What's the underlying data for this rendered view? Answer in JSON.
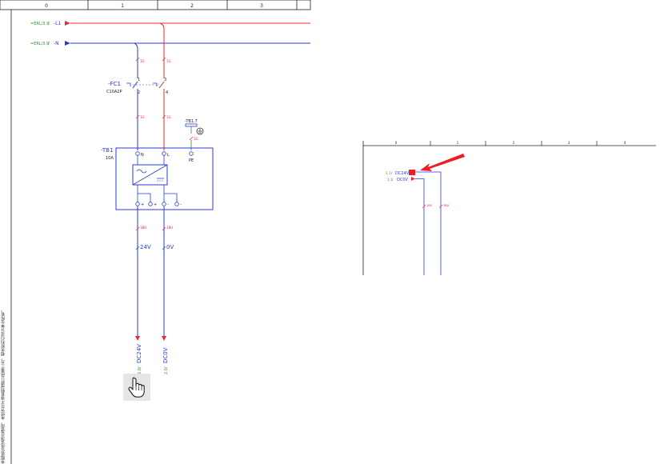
{
  "left_sheet": {
    "columns": [
      "0",
      "1",
      "2",
      "3"
    ],
    "inputs": [
      {
        "ref": "=ERL/3.9",
        "sep": " / ",
        "signal": "-L1"
      },
      {
        "ref": "=ERL/3.9",
        "sep": " / ",
        "signal": "-N"
      }
    ],
    "breaker": {
      "tag": "-FC1",
      "type": "C10A2P",
      "pin_top_left": "1",
      "pin_top_right": "3",
      "pin_bot_left": "2",
      "pin_bot_right": "4"
    },
    "wire_marks": {
      "upper": "1G",
      "mid": "1G",
      "earth": "1G",
      "dc": "1BU"
    },
    "terminal": {
      "tag": "-TB1.7"
    },
    "psu": {
      "tag": "-TB1",
      "rating": "10A",
      "term_n": "N",
      "term_l": "L",
      "term_pe": "PE",
      "out_plus1": "+",
      "out_plus2": "+",
      "out_minus1": "-",
      "out_minus2": "-"
    },
    "labels": {
      "v24": "24V",
      "v0": "0V"
    },
    "outputs": [
      {
        "ref": "2.0",
        "sep": " / ",
        "signal": "DC24V"
      },
      {
        "ref": "2.0",
        "sep": " / ",
        "signal": "DC0V"
      }
    ],
    "side_text": "本图纸仅供该项目使用，未经许可不得复制或转让给第三方，相关权利归设计单位所有。"
  },
  "right_sheet": {
    "columns": [
      "0",
      "1",
      "2",
      "3",
      "4"
    ],
    "inputs": [
      {
        "ref": "1.1",
        "sep": " / ",
        "signal": "DC24V"
      },
      {
        "ref": "1.1",
        "sep": " / ",
        "signal": "DC0V"
      }
    ],
    "wire_marks": {
      "left": "1BU",
      "right": "1BU"
    }
  },
  "colors": {
    "l1": "#e8283a",
    "n": "#2b3bd6",
    "ground": "#3a8a3a",
    "annotation_arrow": "#ee1c24",
    "frame": "#222222",
    "text_blue": "#2b3bd6",
    "text_green": "#3a8a3a"
  },
  "icons": {
    "cursor": "hand-pointer-icon",
    "arrow": "red-arrow-icon",
    "earth": "earth-ground-icon"
  }
}
